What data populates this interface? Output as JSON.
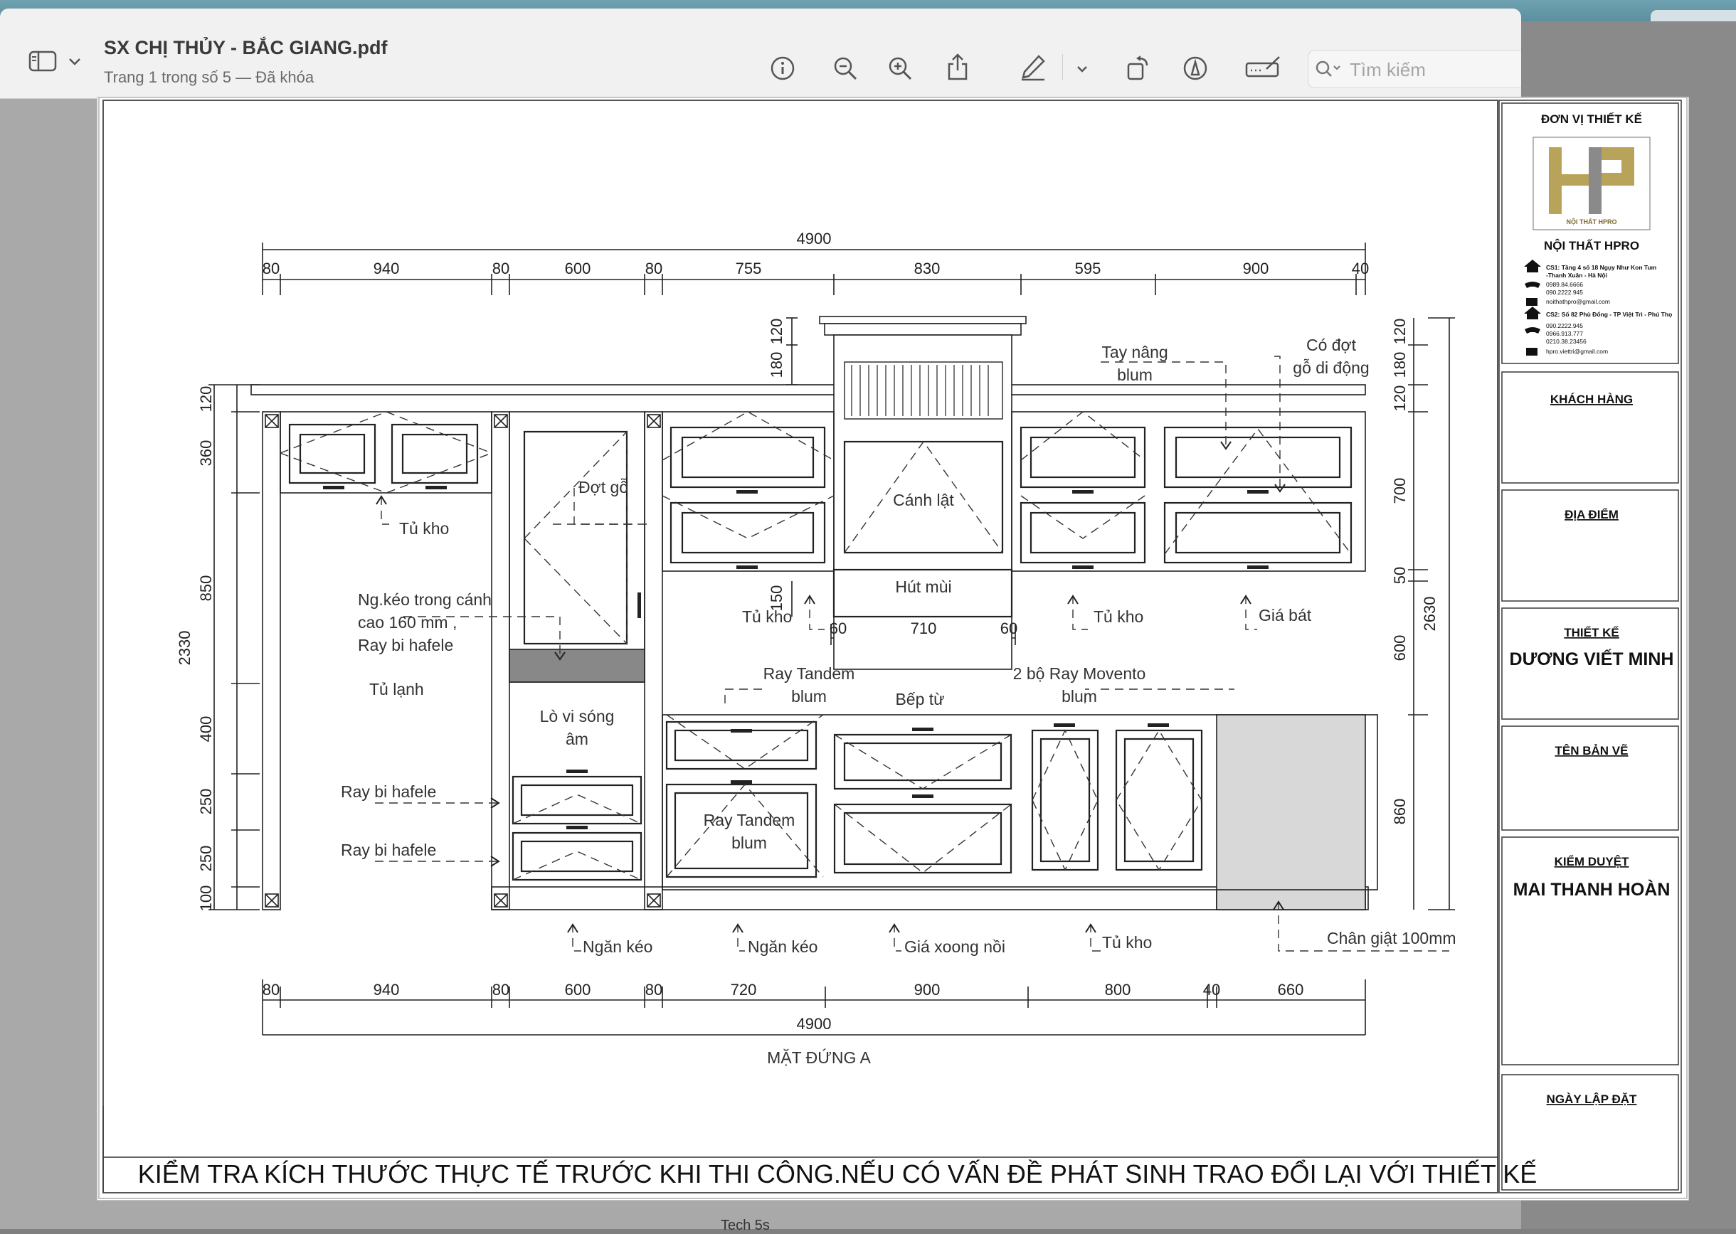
{
  "window": {
    "title": "SX CHỊ THỦY - BẮC GIANG.pdf",
    "subtitle": "Trang 1 trong số 5 — Đã khóa",
    "search_placeholder": "Tìm kiếm",
    "toolbar_icons": [
      "sidebar-icon",
      "chevron-down-icon",
      "info-icon",
      "zoom-out-icon",
      "zoom-in-icon",
      "share-icon",
      "markup-pen-icon",
      "chevron-down-icon",
      "rotate-icon",
      "markup-icon",
      "form-fill-icon",
      "search-icon"
    ],
    "bottom_label": "Tech 5s"
  },
  "drawing": {
    "dims_top_total": "4900",
    "dims_top": [
      "80",
      "940",
      "80",
      "600",
      "80",
      "755",
      "830",
      "595",
      "900",
      "40"
    ],
    "dims_bottom": [
      "80",
      "940",
      "80",
      "600",
      "80",
      "720",
      "900",
      "800",
      "40",
      "660"
    ],
    "dims_bottom_total": "4900",
    "dims_left": [
      "120",
      "360",
      "850",
      "400",
      "250",
      "250",
      "100"
    ],
    "dims_left_total": "2330",
    "dims_right": [
      "120",
      "180",
      "120",
      "700",
      "50",
      "600",
      "860"
    ],
    "dims_right_total": "2630",
    "dims_hood_120": "120",
    "dims_hood_180": "180",
    "dims_hood_150": "150",
    "dims_hood_bottom": [
      "60",
      "710",
      "60"
    ],
    "labels": {
      "tu_kho_1": "Tủ kho",
      "dot_go": "Đợt gỗ",
      "ng_keo_1": "Ng.kéo trong cánh",
      "ng_keo_2": "cao 160 mm ,",
      "ng_keo_3": "Ray bi hafele",
      "tu_lanh": "Tủ lạnh",
      "lo_vi_song_1": "Lò vi sóng",
      "lo_vi_song_2": "âm",
      "ray_bi_1": "Ray bi hafele",
      "ray_bi_2": "Ray bi hafele",
      "tu_kho_2": "Tủ kho",
      "canh_lat": "Cánh lật",
      "hut_mui": "Hút mùi",
      "tay_nang_1": "Tay nâng",
      "tay_nang_2": "blum",
      "co_dot_1": "Có đợt",
      "co_dot_2": "gỗ di động",
      "tu_kho_3": "Tủ kho",
      "gia_bat": "Giá bát",
      "ray_tandem_1": "Ray Tandem",
      "ray_tandem_2": "blum",
      "bep_tu": "Bếp từ",
      "movento_1": "2 bộ Ray Movento",
      "movento_2": "blum",
      "ray_tandem_b1": "Ray Tandem",
      "ray_tandem_b2": "blum",
      "ngan_keo_1": "Ngăn kéo",
      "ngan_keo_2": "Ngăn kéo",
      "gia_xoong": "Giá xoong nồi",
      "tu_kho_4": "Tủ kho",
      "chan_giat": "Chân giật 100mm"
    },
    "view_label": "MẶT ĐỨNG A",
    "footer_note": "KIỂM TRA KÍCH THƯỚC THỰC TẾ TRƯỚC KHI THI CÔNG.NẾU CÓ VẤN ĐỀ PHÁT SINH TRAO ĐỔI LẠI VỚI THIẾT KẾ"
  },
  "title_block": {
    "don_vi": "ĐƠN VỊ THIẾT KẾ",
    "logo_caption": "NỘI THẤT HPRO",
    "company": "NỘI THẤT HPRO",
    "cs1_address": "CS1: Tầng 4 số 18 Ngụy Như Kon Tum",
    "cs1_address2": "-Thanh Xuân - Hà Nội",
    "cs1_phone1": "0989.84.6666",
    "cs1_phone2": "090.2222.945",
    "cs1_email": "noithathpro@gmail.com",
    "cs2_address": "CS2: Số 82 Phù Đổng - TP Việt Trì - Phú Thọ",
    "cs2_phone1": "090.2222.945",
    "cs2_phone2": "0966.913.777",
    "cs2_phone3": "0210.38.23456",
    "cs2_email": "hpro.viettri@gmail.com",
    "khach_hang": "KHÁCH HÀNG",
    "dia_diem": "ĐỊA ĐIỂM",
    "thiet_ke": "THIẾT KẾ",
    "thiet_ke_name": "DƯƠNG VIẾT MINH",
    "ten_ban_ve": "TÊN BẢN VẼ",
    "kiem_duyet": "KIỂM DUYỆT",
    "kiem_duyet_name": "MAI THANH HOÀN",
    "ngay_lap": "NGÀY LẬP ĐẶT"
  }
}
